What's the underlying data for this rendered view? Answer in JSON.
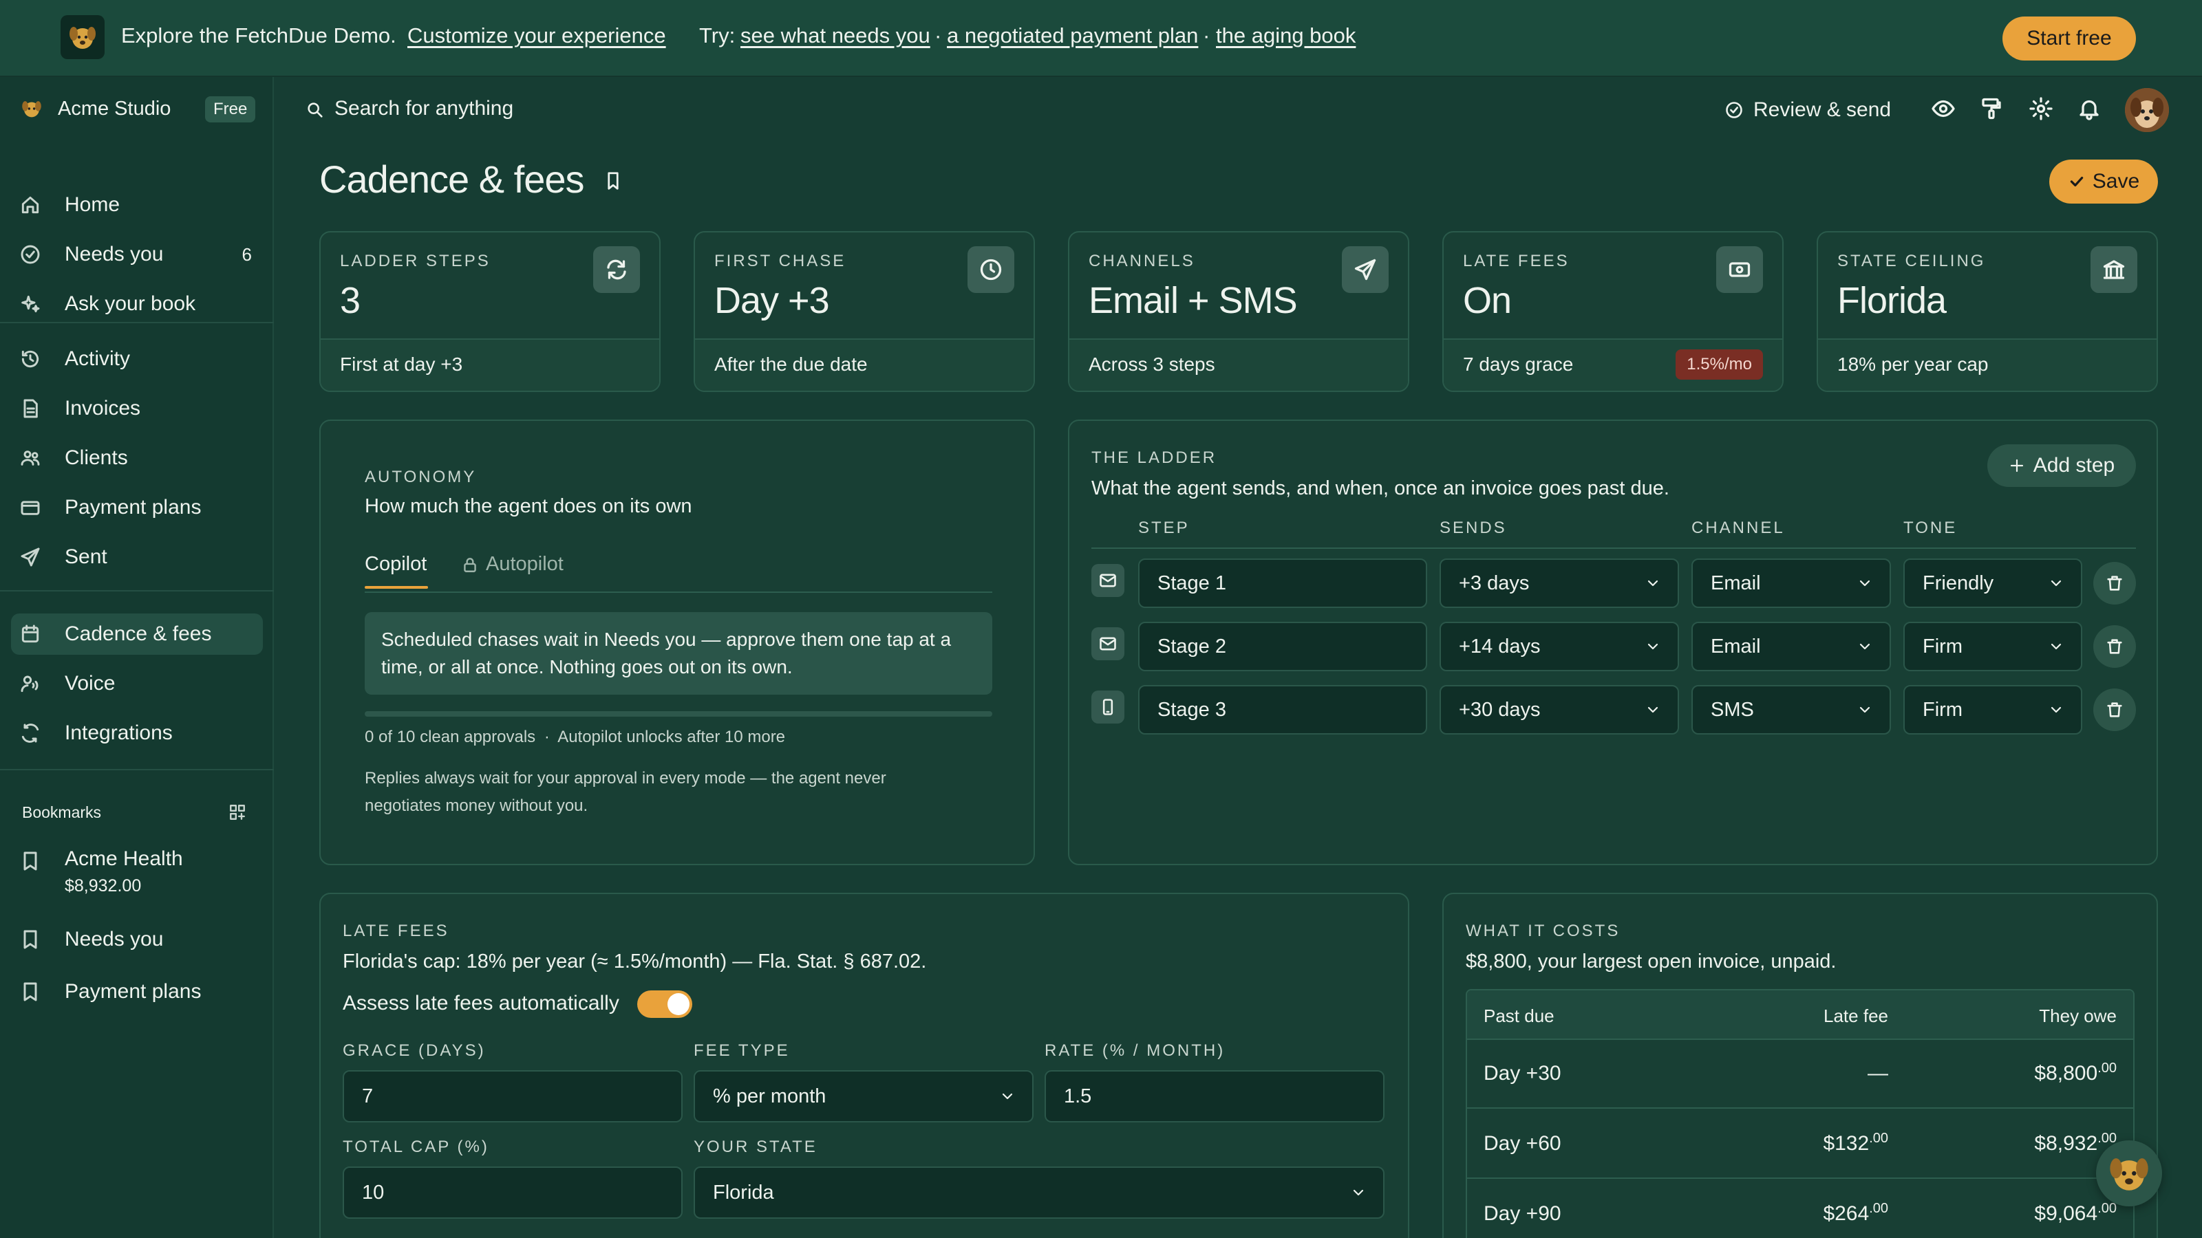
{
  "banner": {
    "intro": "Explore the FetchDue Demo.",
    "customize_link": "Customize your experience",
    "try_label": "Try:",
    "try_links": [
      "see what needs you",
      "a negotiated payment plan",
      "the aging book"
    ],
    "separator": "·",
    "start_free": "Start free"
  },
  "sidebar": {
    "workspace": "Acme Studio",
    "plan_badge": "Free",
    "primary": [
      {
        "label": "Home",
        "icon": "home-icon"
      },
      {
        "label": "Needs you",
        "icon": "check-circle-icon",
        "count": "6"
      },
      {
        "label": "Ask your book",
        "icon": "sparkle-icon"
      }
    ],
    "secondary": [
      {
        "label": "Activity",
        "icon": "history-icon"
      },
      {
        "label": "Invoices",
        "icon": "document-icon"
      },
      {
        "label": "Clients",
        "icon": "users-icon"
      },
      {
        "label": "Payment plans",
        "icon": "card-icon"
      },
      {
        "label": "Sent",
        "icon": "send-icon"
      }
    ],
    "tertiary": [
      {
        "label": "Cadence & fees",
        "icon": "calendar-icon",
        "active": true
      },
      {
        "label": "Voice",
        "icon": "voice-icon"
      },
      {
        "label": "Integrations",
        "icon": "sync-icon"
      }
    ],
    "bookmarks_title": "Bookmarks",
    "bookmarks": [
      {
        "label": "Acme Health",
        "sub": "$8,932.00"
      },
      {
        "label": "Needs you"
      },
      {
        "label": "Payment plans"
      }
    ]
  },
  "topbar": {
    "search_placeholder": "Search for anything",
    "review_send": "Review & send"
  },
  "page": {
    "title": "Cadence & fees",
    "save": "Save"
  },
  "stats": [
    {
      "label": "LADDER STEPS",
      "value": "3",
      "foot": "First at day +3",
      "icon": "repeat-icon"
    },
    {
      "label": "FIRST CHASE",
      "value": "Day +3",
      "foot": "After the due date",
      "icon": "clock-icon"
    },
    {
      "label": "CHANNELS",
      "value": "Email + SMS",
      "foot": "Across 3 steps",
      "icon": "send-icon"
    },
    {
      "label": "LATE FEES",
      "value": "On",
      "foot": "7 days grace",
      "badge": "1.5%/mo",
      "icon": "cash-icon"
    },
    {
      "label": "STATE CEILING",
      "value": "Florida",
      "foot": "18% per year cap",
      "icon": "bank-icon"
    }
  ],
  "autonomy": {
    "label": "AUTONOMY",
    "desc": "How much the agent does on its own",
    "tabs": [
      "Copilot",
      "Autopilot"
    ],
    "info": "Scheduled chases wait in Needs you — approve them one tap at a time, or all at once. Nothing goes out on its own.",
    "progress": 0,
    "progress_text": "0 of 10 clean approvals",
    "progress_sep": "·",
    "unlock_text": "Autopilot unlocks after 10 more",
    "note": "Replies always wait for your approval in every mode — the agent never negotiates money without you."
  },
  "ladder": {
    "label": "THE LADDER",
    "desc": "What the agent sends, and when, once an invoice goes past due.",
    "add_step": "Add step",
    "headers": [
      "STEP",
      "SENDS",
      "CHANNEL",
      "TONE"
    ],
    "rows": [
      {
        "step": "Stage 1",
        "sends": "+3 days",
        "channel": "Email",
        "tone": "Friendly",
        "icon": "mail-icon"
      },
      {
        "step": "Stage 2",
        "sends": "+14 days",
        "channel": "Email",
        "tone": "Firm",
        "icon": "mail-icon"
      },
      {
        "step": "Stage 3",
        "sends": "+30 days",
        "channel": "SMS",
        "tone": "Firm",
        "icon": "phone-icon"
      }
    ]
  },
  "late_fees": {
    "label": "LATE FEES",
    "desc": "Florida's cap: 18% per year (≈ 1.5%/month) — Fla. Stat. § 687.02.",
    "toggle_label": "Assess late fees automatically",
    "toggle_on": true,
    "grace_label": "GRACE (DAYS)",
    "grace_value": "7",
    "fee_type_label": "FEE TYPE",
    "fee_type_value": "% per month",
    "rate_label": "RATE (% / MONTH)",
    "rate_value": "1.5",
    "cap_label": "TOTAL CAP (%)",
    "cap_value": "10",
    "state_label": "YOUR STATE",
    "state_value": "Florida"
  },
  "costs": {
    "label": "WHAT IT COSTS",
    "desc": "$8,800, your largest open invoice, unpaid.",
    "headers": [
      "Past due",
      "Late fee",
      "They owe"
    ],
    "rows": [
      {
        "past": "Day +30",
        "fee": "—",
        "fee_cents": "",
        "owe": "$8,800",
        "owe_cents": "00"
      },
      {
        "past": "Day +60",
        "fee": "$132",
        "fee_cents": "00",
        "owe": "$8,932",
        "owe_cents": "00"
      },
      {
        "past": "Day +90",
        "fee": "$264",
        "fee_cents": "00",
        "owe": "$9,064",
        "owe_cents": "00"
      }
    ]
  },
  "colors": {
    "accent": "#e9a23b",
    "background": "#163d33",
    "panel": "#183f34",
    "danger_badge": "#7a2e24"
  }
}
